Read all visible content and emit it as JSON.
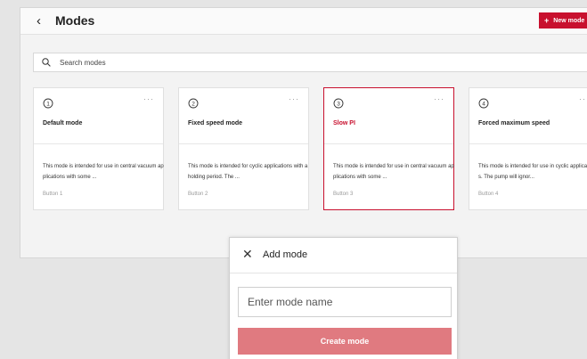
{
  "header": {
    "back_icon": "chevron-left-icon",
    "title": "Modes",
    "new_mode_label": "New mode",
    "new_mode_icon": "+"
  },
  "search": {
    "placeholder": "Search modes",
    "icon": "search-icon"
  },
  "cards": [
    {
      "icon": "1",
      "menu": "···",
      "title": "Default mode",
      "description": "This mode is intended for use in central vacuum applications with some ...",
      "button": "Button 1"
    },
    {
      "icon": "2",
      "menu": "···",
      "title": "Fixed speed mode",
      "description": "This mode is intended for cyclic applications with a holding period. The ...",
      "button": "Button 2"
    },
    {
      "icon": "3",
      "menu": "···",
      "title": "Slow PI",
      "description": "This mode is intended for use in central vacuum applications with some ...",
      "button": "Button 3"
    },
    {
      "icon": "4",
      "menu": "···",
      "title": "Forced maximum speed",
      "description": "This mode is intended for use in cyclic applications. The pump will ignor...",
      "button": "Button 4"
    }
  ],
  "dialog": {
    "title": "Add mode",
    "close_icon": "close-icon",
    "input_placeholder": "Enter mode name",
    "create_label": "Create mode"
  },
  "colors": {
    "accent": "#c8102e",
    "create_button": "#e07a80",
    "background": "#e5e5e5"
  }
}
